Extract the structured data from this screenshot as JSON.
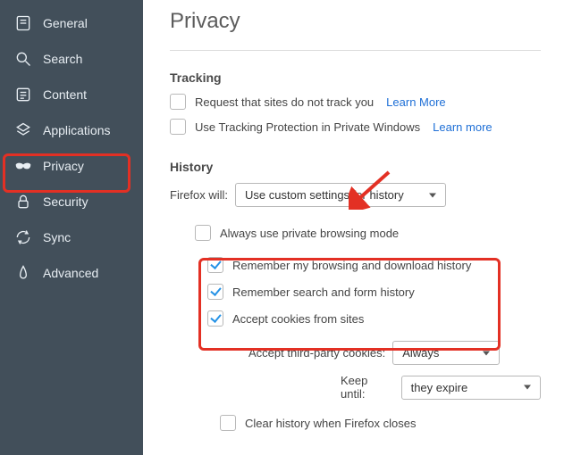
{
  "sidebar": {
    "items": [
      {
        "label": "General"
      },
      {
        "label": "Search"
      },
      {
        "label": "Content"
      },
      {
        "label": "Applications"
      },
      {
        "label": "Privacy"
      },
      {
        "label": "Security"
      },
      {
        "label": "Sync"
      },
      {
        "label": "Advanced"
      }
    ]
  },
  "page": {
    "title": "Privacy"
  },
  "tracking": {
    "heading": "Tracking",
    "do_not_track": {
      "label": "Request that sites do not track you",
      "checked": false,
      "learn": "Learn More"
    },
    "protection": {
      "label": "Use Tracking Protection in Private Windows",
      "checked": false,
      "learn": "Learn more"
    }
  },
  "history": {
    "heading": "History",
    "firefox_will_label": "Firefox will:",
    "firefox_will_value": "Use custom settings for history",
    "private_mode": {
      "label": "Always use private browsing mode",
      "checked": false
    },
    "remember_browsing": {
      "label": "Remember my browsing and download history",
      "checked": true
    },
    "remember_search": {
      "label": "Remember search and form history",
      "checked": true
    },
    "accept_cookies": {
      "label": "Accept cookies from sites",
      "checked": true
    },
    "third_party": {
      "label": "Accept third-party cookies:",
      "value": "Always"
    },
    "keep_until": {
      "label": "Keep until:",
      "value": "they expire"
    },
    "clear_on_close": {
      "label": "Clear history when Firefox closes",
      "checked": false
    }
  }
}
